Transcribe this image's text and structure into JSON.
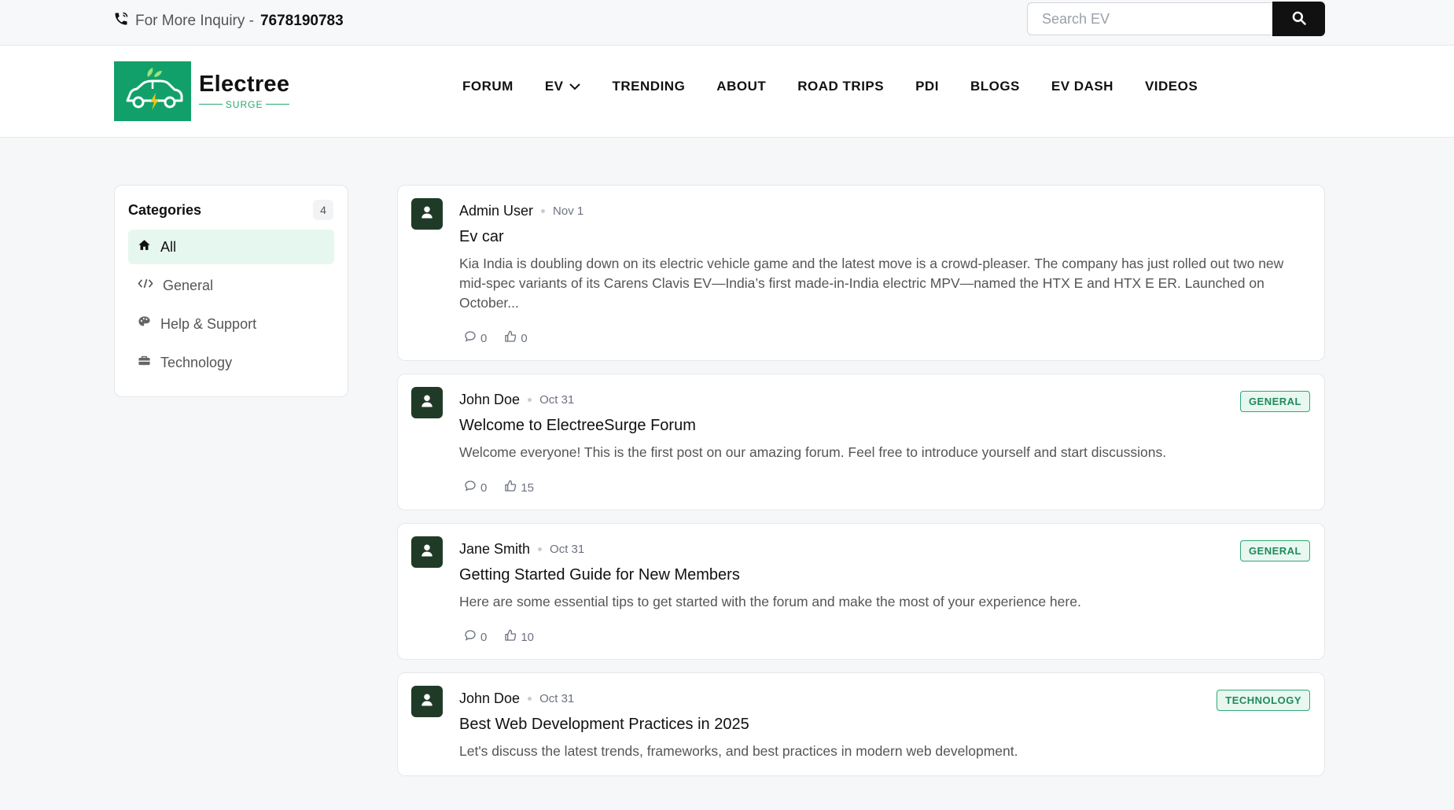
{
  "topbar": {
    "inquiry_label": "For More Inquiry -",
    "phone": "7678190783",
    "search_placeholder": "Search EV"
  },
  "brand": {
    "name": "Electree",
    "tagline": "SURGE"
  },
  "nav": [
    {
      "label": "FORUM"
    },
    {
      "label": "EV"
    },
    {
      "label": "TRENDING"
    },
    {
      "label": "ABOUT"
    },
    {
      "label": "ROAD TRIPS"
    },
    {
      "label": "PDI"
    },
    {
      "label": "BLOGS"
    },
    {
      "label": "EV DASH"
    },
    {
      "label": "VIDEOS"
    }
  ],
  "sidebar": {
    "title": "Categories",
    "count": "4",
    "items": [
      {
        "label": "All",
        "icon": "home-icon",
        "active": true
      },
      {
        "label": "General",
        "icon": "code-icon"
      },
      {
        "label": "Help & Support",
        "icon": "palette-icon"
      },
      {
        "label": "Technology",
        "icon": "briefcase-icon"
      }
    ]
  },
  "posts": [
    {
      "author": "Admin User",
      "date": "Nov 1",
      "title": "Ev car",
      "excerpt": "Kia India is doubling down on its electric vehicle game and the latest move is a crowd-pleaser. The company has just rolled out two new mid-spec variants of its Carens Clavis EV—India’s first made-in-India electric MPV—named the HTX E and HTX E ER. Launched on October...",
      "comments": "0",
      "likes": "0",
      "badge": ""
    },
    {
      "author": "John Doe",
      "date": "Oct 31",
      "title": "Welcome to ElectreeSurge Forum",
      "excerpt": "Welcome everyone! This is the first post on our amazing forum. Feel free to introduce yourself and start discussions.",
      "comments": "0",
      "likes": "15",
      "badge": "GENERAL"
    },
    {
      "author": "Jane Smith",
      "date": "Oct 31",
      "title": "Getting Started Guide for New Members",
      "excerpt": "Here are some essential tips to get started with the forum and make the most of your experience here.",
      "comments": "0",
      "likes": "10",
      "badge": "GENERAL"
    },
    {
      "author": "John Doe",
      "date": "Oct 31",
      "title": "Best Web Development Practices in 2025",
      "excerpt": "Let's discuss the latest trends, frameworks, and best practices in modern web development.",
      "comments": "",
      "likes": "",
      "badge": "TECHNOLOGY"
    }
  ],
  "colors": {
    "brand_green": "#12a06a",
    "avatar_bg": "#1f3b27",
    "active_bg": "#e6f7ef",
    "badge_border": "#2fa878"
  }
}
